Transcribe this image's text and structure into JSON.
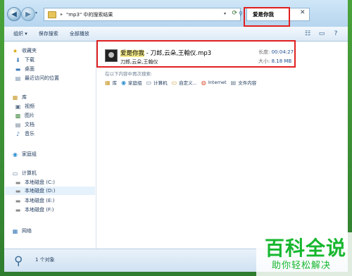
{
  "address": {
    "crumb": "\"mp3\" 中的搜索结果",
    "arrow": "▸",
    "chevron": "▾",
    "refresh": "⟳"
  },
  "search": {
    "value": "爱是你我"
  },
  "toolbar": {
    "organize_label": "组织 ▾",
    "save_search_label": "保存搜索",
    "play_all_label": "全部播放"
  },
  "nav": {
    "favorites": "收藏夹",
    "downloads": "下载",
    "desktop": "桌面",
    "recent": "最近访问的位置",
    "libraries": "库",
    "videos": "视频",
    "pictures": "图片",
    "documents": "文档",
    "music": "音乐",
    "homegroup": "家庭组",
    "computer": "计算机",
    "drive_c": "本地磁盘 (C:)",
    "drive_d": "本地磁盘 (D:)",
    "drive_e": "本地磁盘 (E:)",
    "drive_f": "本地磁盘 (F:)",
    "network": "网络"
  },
  "result": {
    "title_highlight": "爱是你我",
    "title_rest": " - 刀郎,云朵,王翰仪.mp3",
    "artist": "刀郎,云朵,王翰仪",
    "length_label": "长度:",
    "length_value": "00:04:27",
    "size_label": "大小:",
    "size_value": "8.18 MB"
  },
  "search_again": {
    "label": "在以下内容中再次搜索:",
    "options": [
      "库",
      "家庭组",
      "计算机",
      "自定义...",
      "Internet",
      "文件内容"
    ]
  },
  "status": {
    "text": "1 个对象"
  },
  "watermark": {
    "line1": "百科全说",
    "line2": "助你轻松解决"
  },
  "colors": {
    "highlight_box": "#e02020",
    "watermark": "#17b72f",
    "frame": "#3a9a3a"
  }
}
